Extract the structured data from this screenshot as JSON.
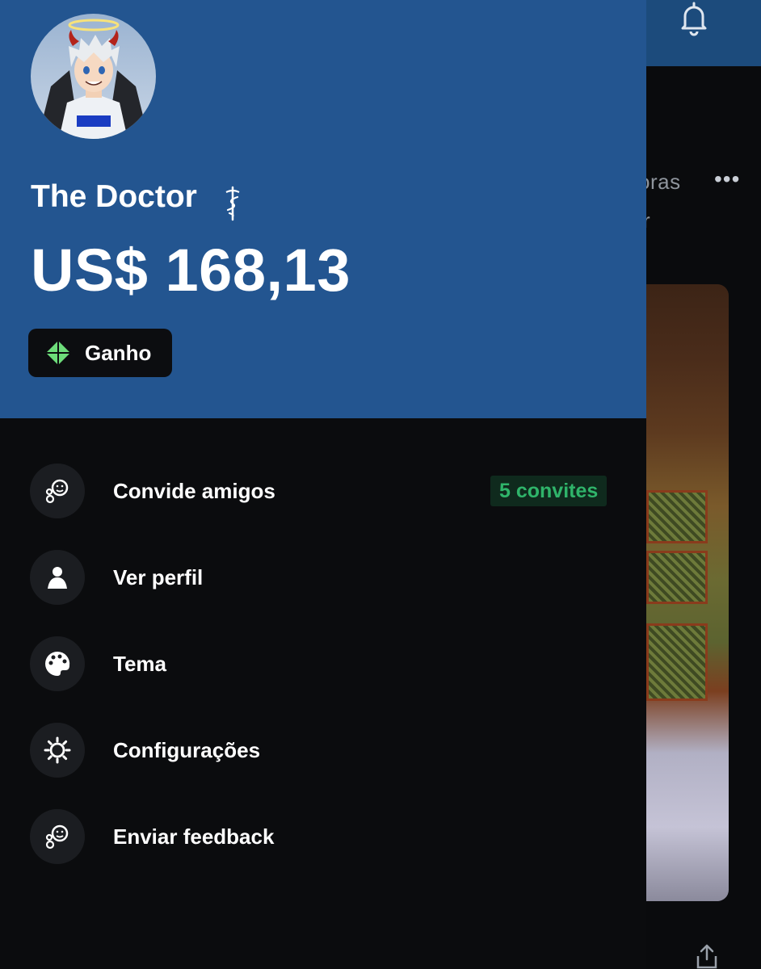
{
  "profile": {
    "name": "The Doctor",
    "balance": "US$ 168,13",
    "earn_label": "Ganho"
  },
  "menu": {
    "items": [
      {
        "label": "Convide amigos",
        "icon": "invite-friends-icon"
      },
      {
        "label": "Ver perfil",
        "icon": "person-icon"
      },
      {
        "label": "Tema",
        "icon": "palette-icon"
      },
      {
        "label": "Configurações",
        "icon": "gear-icon"
      },
      {
        "label": "Enviar feedback",
        "icon": "feedback-icon"
      }
    ],
    "invite_badge": "5 convites"
  },
  "background": {
    "post_meta": "oras",
    "post_author": "r",
    "more_label": "•••"
  },
  "colors": {
    "header_blue": "#235590",
    "drawer_bg": "#0b0c0e",
    "badge_green": "#2fb46a",
    "earn_diamond": "#6ddc7a"
  }
}
